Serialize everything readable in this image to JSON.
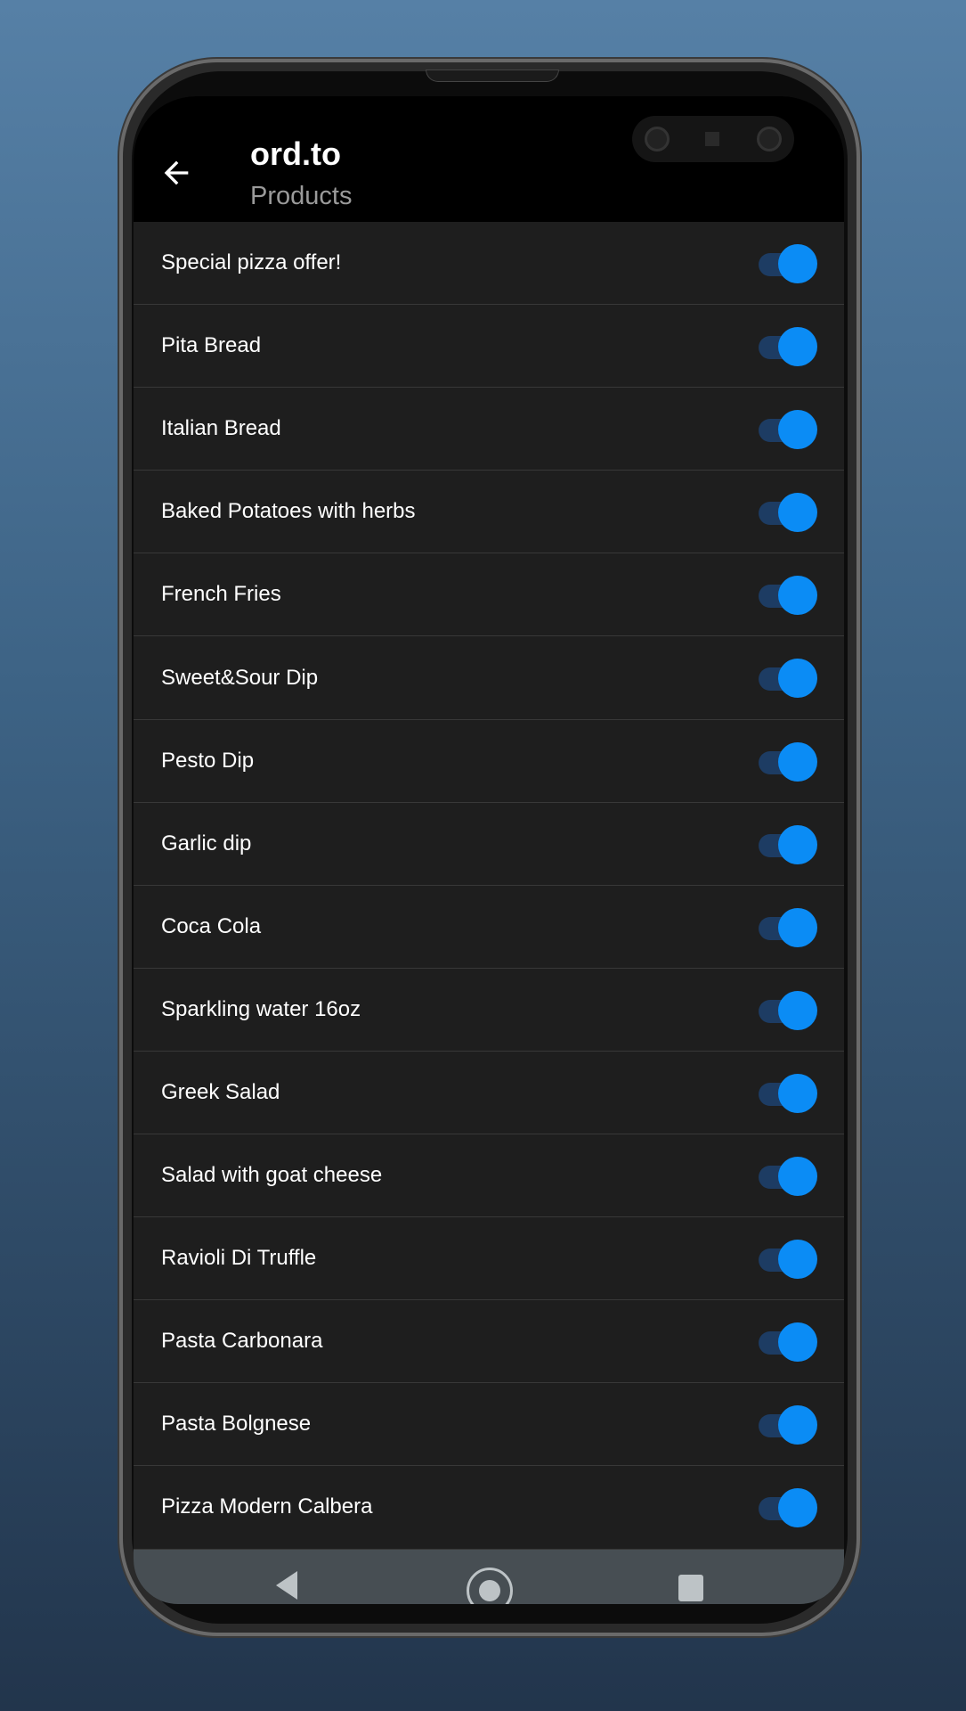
{
  "app": {
    "title": "ord.to",
    "subtitle": "Products"
  },
  "colors": {
    "accent": "#0b8cf5",
    "track": "#1d3c63",
    "background": "#1e1e1e",
    "appbar": "#000000",
    "navbar": "#474e53"
  },
  "products": [
    {
      "name": "Special pizza offer!",
      "enabled": true
    },
    {
      "name": "Pita Bread",
      "enabled": true
    },
    {
      "name": "Italian Bread",
      "enabled": true
    },
    {
      "name": "Baked Potatoes with herbs",
      "enabled": true
    },
    {
      "name": "French Fries",
      "enabled": true
    },
    {
      "name": "Sweet&Sour Dip",
      "enabled": true
    },
    {
      "name": "Pesto Dip",
      "enabled": true
    },
    {
      "name": "Garlic dip",
      "enabled": true
    },
    {
      "name": "Coca Cola",
      "enabled": true
    },
    {
      "name": "Sparkling water 16oz",
      "enabled": true
    },
    {
      "name": "Greek Salad",
      "enabled": true
    },
    {
      "name": "Salad with goat cheese",
      "enabled": true
    },
    {
      "name": "Ravioli Di Truffle",
      "enabled": true
    },
    {
      "name": "Pasta Carbonara",
      "enabled": true
    },
    {
      "name": "Pasta Bolgnese",
      "enabled": true
    },
    {
      "name": "Pizza Modern Calbera",
      "enabled": true
    }
  ],
  "nav": {
    "icons": [
      "back-triangle-icon",
      "home-circle-icon",
      "recents-square-icon"
    ]
  }
}
